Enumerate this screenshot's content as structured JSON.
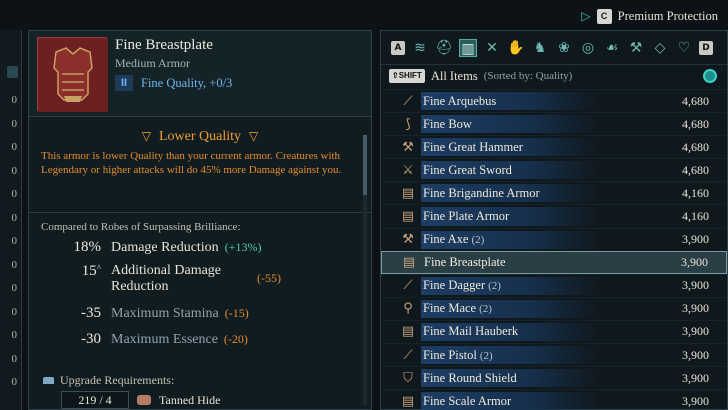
{
  "header": {
    "premium_label": "Premium Protection",
    "premium_key": "C"
  },
  "left_strip": {
    "numbers": [
      "0",
      "0",
      "0",
      "0",
      "0",
      "0",
      "0",
      "0",
      "0",
      "0",
      "0",
      "0",
      "0"
    ]
  },
  "item": {
    "name": "Fine Breastplate",
    "type": "Medium Armor",
    "tier": "II",
    "quality": "Fine Quality, +0/3",
    "warning_title": "Lower Quality",
    "warning_text": "This armor is lower Quality than your current armor. Creatures with Legendary or higher attacks will do 45% more Damage against you.",
    "compare_heading": "Compared to Robes of Surpassing Brilliance:",
    "stats": [
      {
        "value": "18%",
        "name": "Damage Reduction",
        "delta": "(+13%)"
      },
      {
        "value": "15",
        "name": "Additional Damage Reduction",
        "delta": "(-55)"
      },
      {
        "value": "-35",
        "name": "Maximum Stamina",
        "delta": "(-15)"
      },
      {
        "value": "-30",
        "name": "Maximum Essence",
        "delta": "(-20)"
      }
    ],
    "upgrade_heading": "Upgrade Requirements:",
    "requirement": {
      "count": "219 / 4",
      "name": "Tanned Hide"
    }
  },
  "inventory": {
    "tab_key_left": "A",
    "tab_key_right": "D",
    "shift_key": "⇧SHIFT",
    "sort_label": "All Items",
    "sort_detail": "(Sorted by: Quality)",
    "tabs": [
      "stack-icon",
      "helmet-icon",
      "armor-icon",
      "weapons-icon",
      "gloves-icon",
      "boots-icon",
      "herbs-icon",
      "ring-icon",
      "hands-icon",
      "anvil-icon",
      "gem-icon",
      "shield-icon"
    ],
    "items": [
      {
        "name": "Fine Arquebus",
        "count": "",
        "price": "4,680",
        "icon": "gun-icon"
      },
      {
        "name": "Fine Bow",
        "count": "",
        "price": "4,680",
        "icon": "bow-icon"
      },
      {
        "name": "Fine Great Hammer",
        "count": "",
        "price": "4,680",
        "icon": "hammer-icon"
      },
      {
        "name": "Fine Great Sword",
        "count": "",
        "price": "4,680",
        "icon": "sword-icon"
      },
      {
        "name": "Fine Brigandine Armor",
        "count": "",
        "price": "4,160",
        "icon": "armor-icon"
      },
      {
        "name": "Fine Plate Armor",
        "count": "",
        "price": "4,160",
        "icon": "armor-icon"
      },
      {
        "name": "Fine Axe",
        "count": "(2)",
        "price": "3,900",
        "icon": "axe-icon"
      },
      {
        "name": "Fine Breastplate",
        "count": "",
        "price": "3,900",
        "icon": "armor-icon",
        "selected": true
      },
      {
        "name": "Fine Dagger",
        "count": "(2)",
        "price": "3,900",
        "icon": "dagger-icon"
      },
      {
        "name": "Fine Mace",
        "count": "(2)",
        "price": "3,900",
        "icon": "mace-icon"
      },
      {
        "name": "Fine Mail Hauberk",
        "count": "",
        "price": "3,900",
        "icon": "armor-icon"
      },
      {
        "name": "Fine Pistol",
        "count": "(2)",
        "price": "3,900",
        "icon": "pistol-icon"
      },
      {
        "name": "Fine Round Shield",
        "count": "",
        "price": "3,900",
        "icon": "shield-icon"
      },
      {
        "name": "Fine Scale Armor",
        "count": "",
        "price": "3,900",
        "icon": "armor-icon"
      }
    ]
  }
}
